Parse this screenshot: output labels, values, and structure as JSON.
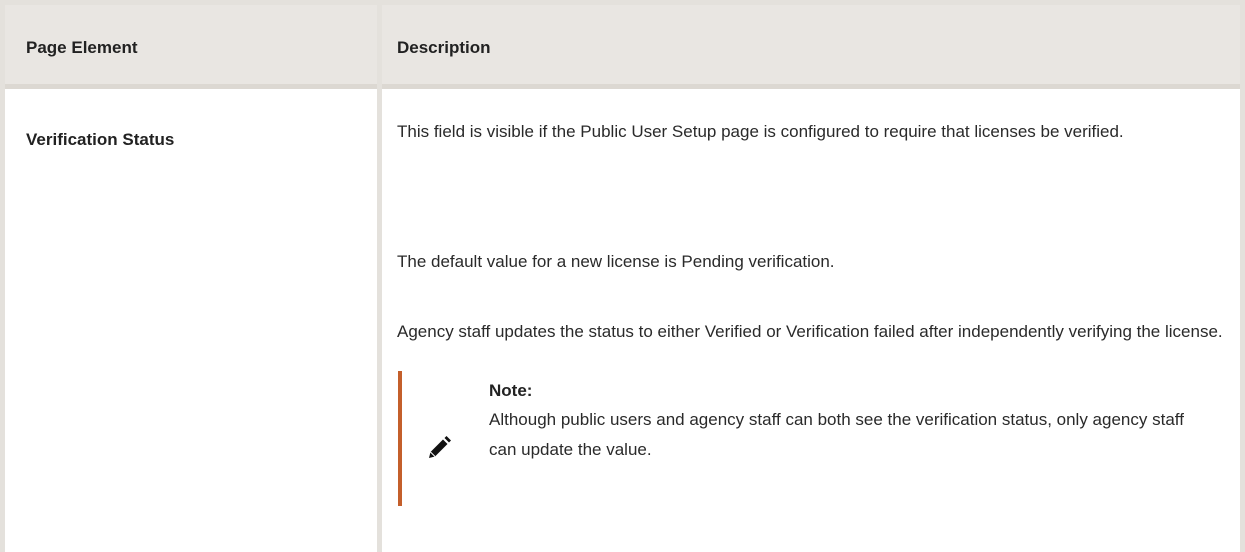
{
  "table": {
    "headers": {
      "col1": "Page Element",
      "col2": "Description"
    },
    "rows": [
      {
        "element": "Verification Status",
        "paragraphs": [
          "This field is visible if the Public User Setup page is configured to require that licenses be verified.",
          "The default value for a new license is Pending verification.",
          "Agency staff updates the status to either Verified or Verification failed after independently verifying the license."
        ],
        "note": {
          "icon": "pencil-icon",
          "title": "Note:",
          "text": "Although public users and agency staff can both see the verification status, only agency staff can update the value."
        }
      }
    ]
  },
  "colors": {
    "header_bg": "#e9e6e2",
    "border": "#e4e1dc",
    "note_accent": "#c45f2b"
  }
}
